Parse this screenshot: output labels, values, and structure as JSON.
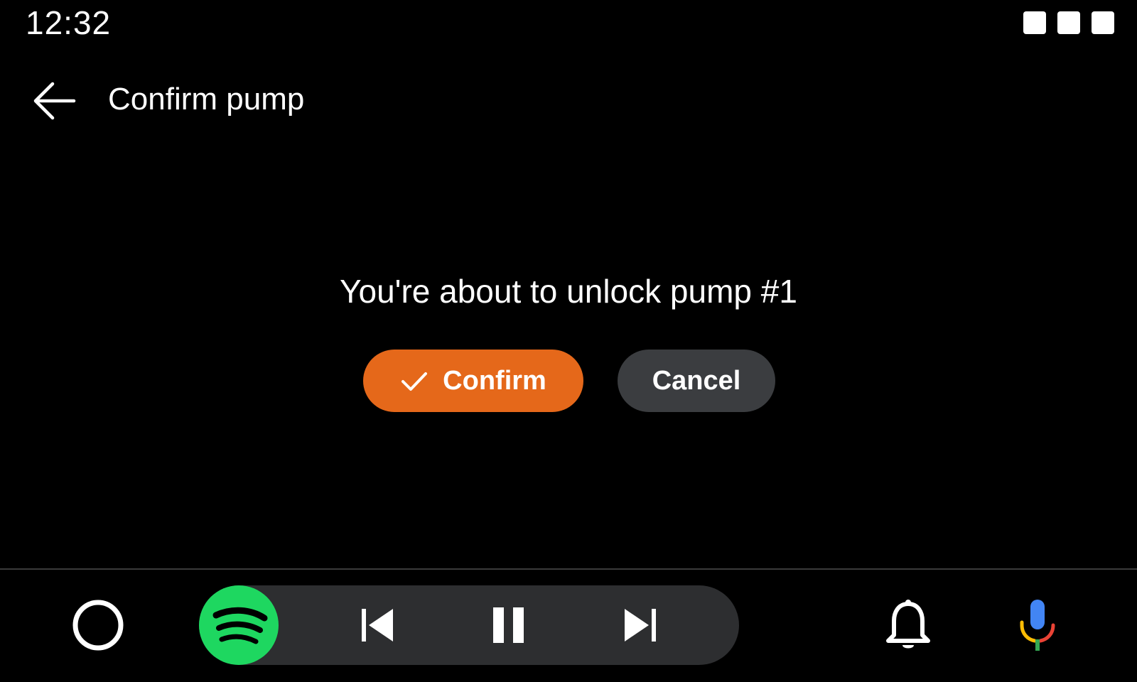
{
  "status_bar": {
    "time": "12:32"
  },
  "header": {
    "title": "Confirm pump",
    "back_icon": "arrow-back-icon"
  },
  "main": {
    "message": "You're about to unlock pump #1",
    "confirm_label": "Confirm",
    "confirm_icon": "check-icon",
    "cancel_label": "Cancel"
  },
  "bottom_bar": {
    "home_icon": "home-circle-icon",
    "media_app_icon": "spotify-logo",
    "controls": [
      "previous-track-icon",
      "pause-icon",
      "next-track-icon"
    ],
    "notifications_icon": "bell-icon",
    "assistant_icon": "microphone-icon"
  },
  "colors": {
    "background": "#000000",
    "confirm": "#e5681a",
    "cancel": "#3b3d40",
    "media_pill": "#2d2e30",
    "spotify": "#1ed760"
  }
}
